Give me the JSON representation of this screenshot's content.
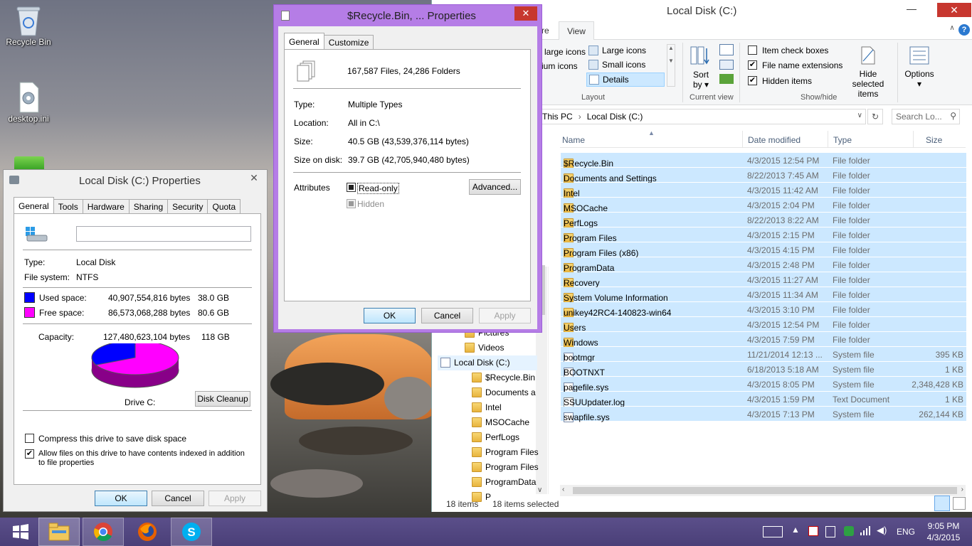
{
  "desktop": {
    "icons": [
      {
        "label": "Recycle Bin"
      },
      {
        "label": "desktop.ini"
      }
    ]
  },
  "disk_props": {
    "title": "Local Disk (C:) Properties",
    "tabs": [
      "General",
      "Tools",
      "Hardware",
      "Sharing",
      "Security",
      "Quota"
    ],
    "name_value": "",
    "type_label": "Type:",
    "type_value": "Local Disk",
    "fs_label": "File system:",
    "fs_value": "NTFS",
    "used_label": "Used space:",
    "used_bytes": "40,907,554,816 bytes",
    "used_gb": "38.0 GB",
    "free_label": "Free space:",
    "free_bytes": "86,573,068,288 bytes",
    "free_gb": "80.6 GB",
    "cap_label": "Capacity:",
    "cap_bytes": "127,480,623,104 bytes",
    "cap_gb": "118 GB",
    "used_fraction": 0.321,
    "used_color": "#0000ff",
    "free_color": "#ff00ff",
    "drive_label": "Drive C:",
    "cleanup": "Disk Cleanup",
    "compress": "Compress this drive to save disk space",
    "index": "Allow files on this drive to have contents indexed in addition to file properties",
    "ok": "OK",
    "cancel": "Cancel",
    "apply": "Apply"
  },
  "recycle_props": {
    "title": "$Recycle.Bin, ... Properties",
    "tabs": [
      "General",
      "Customize"
    ],
    "summary": "167,587 Files, 24,286 Folders",
    "type_label": "Type:",
    "type_value": "Multiple Types",
    "loc_label": "Location:",
    "loc_value": "All in C:\\",
    "size_label": "Size:",
    "size_value": "40.5 GB (43,539,376,114 bytes)",
    "sod_label": "Size on disk:",
    "sod_value": "39.7 GB (42,705,940,480 bytes)",
    "attr_label": "Attributes",
    "readonly": "Read-only",
    "hidden": "Hidden",
    "advanced": "Advanced...",
    "ok": "OK",
    "cancel": "Cancel",
    "apply": "Apply"
  },
  "explorer": {
    "title": "Local Disk (C:)",
    "tab_partial": "re",
    "tab_view": "View",
    "layout": {
      "large_icons_partial": "large icons",
      "medium_icons_partial": "ium icons",
      "large_icons": "Large icons",
      "small_icons": "Small icons",
      "details": "Details",
      "label": "Layout"
    },
    "current_view": {
      "sort": "Sort",
      "by": "by",
      "label": "Current view"
    },
    "show_hide": {
      "item_check": "Item check boxes",
      "ext": "File name extensions",
      "hidden": "Hidden items",
      "hide_selected": "Hide selected",
      "items": "items",
      "label": "Show/hide"
    },
    "options": "Options",
    "breadcrumb": [
      "This PC",
      "Local Disk (C:)"
    ],
    "search_placeholder": "Search Lo...",
    "columns": [
      "Name",
      "Date modified",
      "Type",
      "Size"
    ],
    "files": [
      {
        "name": "$Recycle.Bin",
        "date": "4/3/2015 12:54 PM",
        "type": "File folder",
        "size": "",
        "icon": "folder"
      },
      {
        "name": "Documents and Settings",
        "date": "8/22/2013 7:45 AM",
        "type": "File folder",
        "size": "",
        "icon": "shortcut"
      },
      {
        "name": "Intel",
        "date": "4/3/2015 11:42 AM",
        "type": "File folder",
        "size": "",
        "icon": "folder"
      },
      {
        "name": "MSOCache",
        "date": "4/3/2015 2:04 PM",
        "type": "File folder",
        "size": "",
        "icon": "folder"
      },
      {
        "name": "PerfLogs",
        "date": "8/22/2013 8:22 AM",
        "type": "File folder",
        "size": "",
        "icon": "folder"
      },
      {
        "name": "Program Files",
        "date": "4/3/2015 2:15 PM",
        "type": "File folder",
        "size": "",
        "icon": "folder"
      },
      {
        "name": "Program Files (x86)",
        "date": "4/3/2015 4:15 PM",
        "type": "File folder",
        "size": "",
        "icon": "folder"
      },
      {
        "name": "ProgramData",
        "date": "4/3/2015 2:48 PM",
        "type": "File folder",
        "size": "",
        "icon": "folder"
      },
      {
        "name": "Recovery",
        "date": "4/3/2015 11:27 AM",
        "type": "File folder",
        "size": "",
        "icon": "folder"
      },
      {
        "name": "System Volume Information",
        "date": "4/3/2015 11:34 AM",
        "type": "File folder",
        "size": "",
        "icon": "folder"
      },
      {
        "name": "unikey42RC4-140823-win64",
        "date": "4/3/2015 3:10 PM",
        "type": "File folder",
        "size": "",
        "icon": "folder"
      },
      {
        "name": "Users",
        "date": "4/3/2015 12:54 PM",
        "type": "File folder",
        "size": "",
        "icon": "folder"
      },
      {
        "name": "Windows",
        "date": "4/3/2015 7:59 PM",
        "type": "File folder",
        "size": "",
        "icon": "folder"
      },
      {
        "name": "bootmgr",
        "date": "11/21/2014 12:13 ...",
        "type": "System file",
        "size": "395 KB",
        "icon": "sys"
      },
      {
        "name": "BOOTNXT",
        "date": "6/18/2013 5:18 AM",
        "type": "System file",
        "size": "1 KB",
        "icon": "sys"
      },
      {
        "name": "pagefile.sys",
        "date": "4/3/2015 8:05 PM",
        "type": "System file",
        "size": "2,348,428 KB",
        "icon": "sys"
      },
      {
        "name": "SSUUpdater.log",
        "date": "4/3/2015 1:59 PM",
        "type": "Text Document",
        "size": "1 KB",
        "icon": "file"
      },
      {
        "name": "swapfile.sys",
        "date": "4/3/2015 7:13 PM",
        "type": "System file",
        "size": "262,144 KB",
        "icon": "sys"
      }
    ],
    "tree": [
      {
        "label": "Pictures",
        "indent": 0
      },
      {
        "label": "Videos",
        "indent": 0
      },
      {
        "label": "Local Disk (C:)",
        "indent": -1
      },
      {
        "label": "$Recycle.Bin",
        "indent": 1
      },
      {
        "label": "Documents a",
        "indent": 1
      },
      {
        "label": "Intel",
        "indent": 1
      },
      {
        "label": "MSOCache",
        "indent": 1
      },
      {
        "label": "PerfLogs",
        "indent": 1
      },
      {
        "label": "Program Files",
        "indent": 1
      },
      {
        "label": "Program Files",
        "indent": 1
      },
      {
        "label": "ProgramData",
        "indent": 1
      },
      {
        "label": "P",
        "indent": 1
      }
    ],
    "status_count": "18 items",
    "status_selected": "18 items selected"
  },
  "taskbar": {
    "time": "9:05 PM",
    "date": "4/3/2015",
    "lang": "ENG"
  }
}
